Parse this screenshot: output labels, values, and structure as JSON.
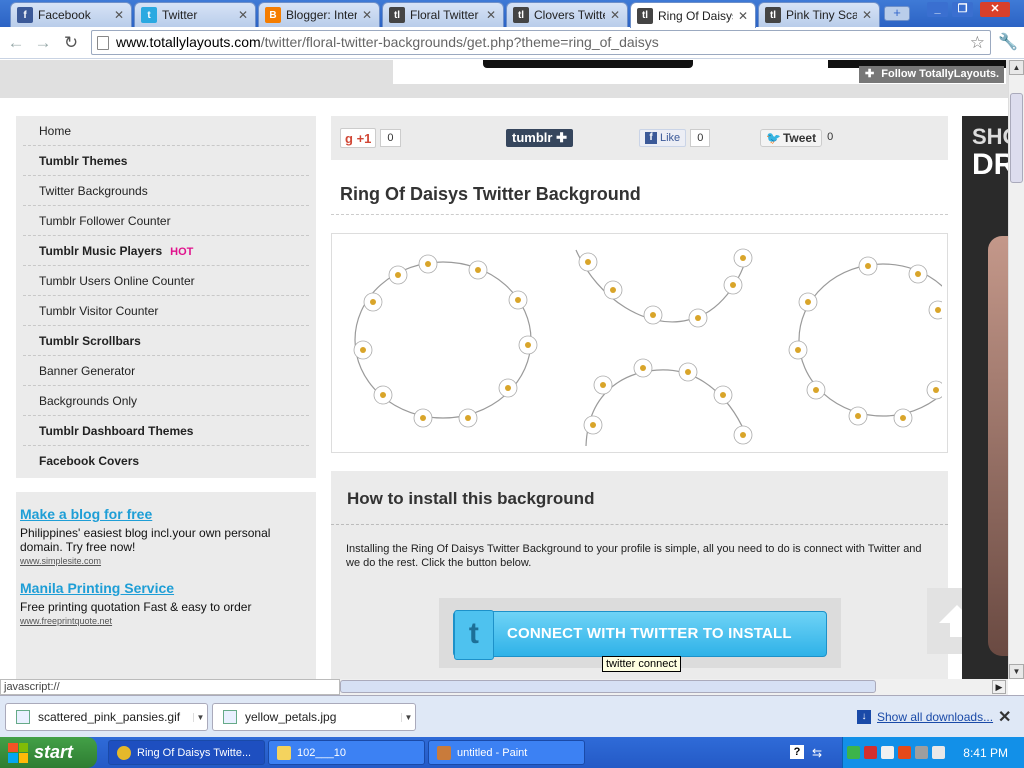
{
  "browser": {
    "tabs": [
      {
        "label": "Facebook",
        "icon": "facebook-icon",
        "color": "#3b5998",
        "glyph": "f"
      },
      {
        "label": "Twitter",
        "icon": "twitter-icon",
        "color": "#2ba9e1",
        "glyph": "t"
      },
      {
        "label": "Blogger: Interir",
        "icon": "blogger-icon",
        "color": "#f57d00",
        "glyph": "B"
      },
      {
        "label": "Floral Twitter Ba",
        "icon": "totallylayouts-icon",
        "color": "#444444",
        "glyph": "tl"
      },
      {
        "label": "Clovers Twitter",
        "icon": "totallylayouts-icon",
        "color": "#444444",
        "glyph": "tl"
      },
      {
        "label": "Ring Of Daisys T",
        "icon": "totallylayouts-icon",
        "color": "#444444",
        "glyph": "tl",
        "active": true
      },
      {
        "label": "Pink Tiny Scatte",
        "icon": "totallylayouts-icon",
        "color": "#444444",
        "glyph": "tl"
      }
    ],
    "url_host": "www.totallylayouts.com",
    "url_path": "/twitter/floral-twitter-backgrounds/get.php?theme=ring_of_daisys",
    "status_text": "javascript://"
  },
  "page": {
    "follow_label": "Follow",
    "follow_brand": "TotallyLayouts.",
    "sidebar": [
      {
        "label": "Home",
        "bold": false
      },
      {
        "label": "Tumblr Themes",
        "bold": true
      },
      {
        "label": "Twitter Backgrounds",
        "bold": false
      },
      {
        "label": "Tumblr Follower Counter",
        "bold": false
      },
      {
        "label": "Tumblr Music Players",
        "bold": true,
        "badge": "HOT"
      },
      {
        "label": "Tumblr Users Online Counter",
        "bold": false
      },
      {
        "label": "Tumblr Visitor Counter",
        "bold": false
      },
      {
        "label": "Tumblr Scrollbars",
        "bold": true
      },
      {
        "label": "Banner Generator",
        "bold": false
      },
      {
        "label": "Backgrounds Only",
        "bold": false
      },
      {
        "label": "Tumblr Dashboard Themes",
        "bold": true
      },
      {
        "label": "Facebook Covers",
        "bold": true
      }
    ],
    "ads": [
      {
        "title": "Make a blog for free",
        "desc": "Philippines' easiest blog incl.your own personal domain. Try free now!",
        "url": "www.simplesite.com"
      },
      {
        "title": "Manila Printing Service",
        "desc": "Free printing quotation Fast & easy to order",
        "url": "www.freeprintquote.net"
      }
    ],
    "share": {
      "gplus_label": "+1",
      "gplus_count": "0",
      "tumblr_label": "tumblr",
      "fb_label": "Like",
      "fb_count": "0",
      "tweet_label": "Tweet",
      "tweet_count": "0"
    },
    "title": "Ring Of Daisys Twitter Background",
    "install_heading": "How to install this background",
    "install_text": "Installing the Ring Of Daisys Twitter Background to your profile is simple, all you need to do is connect with Twitter and we do the rest. Click the button below.",
    "connect_label": "CONNECT WITH TWITTER TO INSTALL",
    "tooltip": "twitter connect",
    "right_ad_line1": "SHO",
    "right_ad_line2": "DR"
  },
  "downloads": {
    "items": [
      {
        "label": "scattered_pink_pansies.gif"
      },
      {
        "label": "yellow_petals.jpg"
      }
    ],
    "show_all": "Show all downloads..."
  },
  "taskbar": {
    "start": "start",
    "tasks": [
      {
        "label": "Ring Of Daisys Twitte...",
        "icon": "chrome-icon",
        "color": "#e5b82a"
      },
      {
        "label": "102___10",
        "icon": "folder-icon",
        "color": "#f4d35e"
      },
      {
        "label": "untitled - Paint",
        "icon": "paint-icon",
        "color": "#c97b3b"
      }
    ],
    "clock": "8:41 PM"
  }
}
